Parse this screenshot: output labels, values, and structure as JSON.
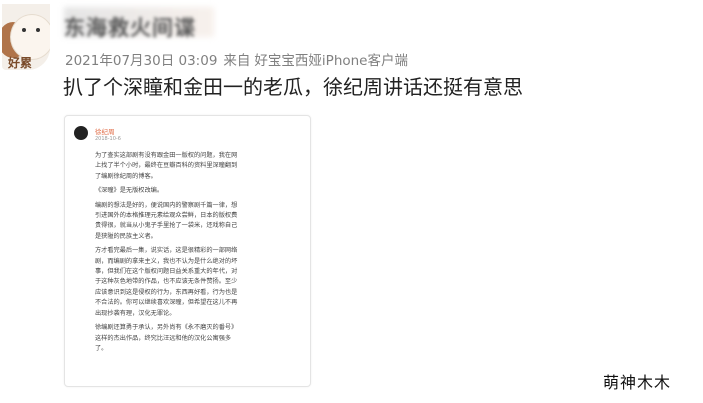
{
  "post": {
    "avatar_text": "好累",
    "username": "东海救火间谍",
    "time": "2021年07月30日 03:09",
    "source_prefix": "来自",
    "source": "好宝宝西娅iPhone客户端",
    "text": "扒了个深瞳和金田一的老瓜，徐纪周讲话还挺有意思"
  },
  "screenshot": {
    "author": "徐纪周",
    "date": "2018-10-6",
    "paragraphs": [
      "为了查实这部剧有没有跟金田一版权的问题，我在网",
      "上找了半个小时，最终在豆瓣百科的资料里深瞳翻到",
      "了编剧徐纪周的博客。",
      "《深瞳》是无版权改编。",
      "编剧的想法是好的，便说国内的警察剧千篇一律，想",
      "引进国外的本格推理元素给观众尝鲜，日本的版权费",
      "贵得很，就当从小鬼子手里抢了一袋米，还戏称自己",
      "是狭隘的民族主义者。",
      "方才看完最后一集，说实话，这是很精彩的一部网络",
      "剧，而编剧的拿来主义，我也不认为是什么绝对的坏",
      "事，但我们在这个版权问题日益关系重大的年代，对",
      "于这种灰色地带的作品，也不应该无条件赞扬。至少",
      "应该意识到这是侵权的行为，东西再好看，行为也是",
      "不合法的。你可以继续喜欢深瞳，但希望在这儿不再",
      "出现抄袭有理，汉化无罪论。",
      "徐编剧还算勇于承认，另外尚有《永不磨灭的番号》",
      "这样的杰出作品，终究比汪远和他的汉化公寓强多",
      "了。"
    ]
  },
  "watermark": "萌神木木"
}
